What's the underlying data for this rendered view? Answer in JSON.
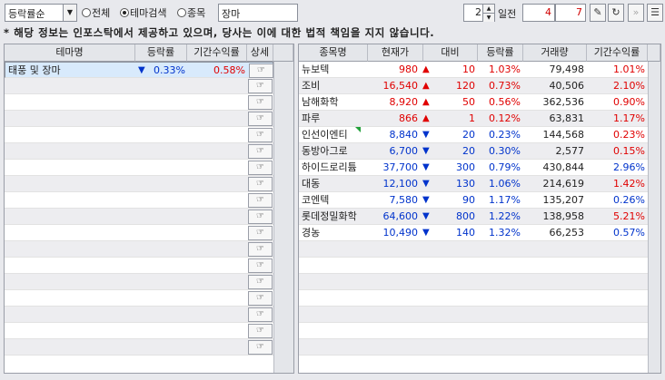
{
  "toolbar": {
    "sort_select": "등락률순",
    "radio_options": [
      {
        "label": "전체",
        "checked": false
      },
      {
        "label": "테마검색",
        "checked": true
      },
      {
        "label": "종목",
        "checked": false
      }
    ],
    "search_value": "장마",
    "days_value": "2",
    "days_label": "일전",
    "range_from": "4",
    "range_to": "7"
  },
  "notice": "* 해당 정보는 인포스탁에서 제공하고 있으며, 당사는 이에 대한 법적 책임을 지지 않습니다.",
  "theme_table": {
    "headers": [
      "테마명",
      "등락률",
      "기간수익률",
      "상세"
    ],
    "rows": [
      {
        "name": "태풍 및 장마",
        "change_arrow": "▼",
        "change": "0.33%",
        "period_return": "0.58%"
      }
    ],
    "detail_icon": "☞",
    "total_rows": 18
  },
  "stock_table": {
    "headers": [
      "종목명",
      "현재가",
      "대비",
      "등락률",
      "거래량",
      "기간수익률"
    ],
    "rows": [
      {
        "name": "뉴보텍",
        "price": "980",
        "dir": "up",
        "arrow": "▲",
        "diff": "10",
        "rate": "1.03%",
        "volume": "79,498",
        "period": "1.01%",
        "period_dir": "up"
      },
      {
        "name": "조비",
        "price": "16,540",
        "dir": "up",
        "arrow": "▲",
        "diff": "120",
        "rate": "0.73%",
        "volume": "40,506",
        "period": "2.10%",
        "period_dir": "up"
      },
      {
        "name": "남해화학",
        "price": "8,920",
        "dir": "up",
        "arrow": "▲",
        "diff": "50",
        "rate": "0.56%",
        "volume": "362,536",
        "period": "0.90%",
        "period_dir": "up"
      },
      {
        "name": "파루",
        "price": "866",
        "dir": "up",
        "arrow": "▲",
        "diff": "1",
        "rate": "0.12%",
        "volume": "63,831",
        "period": "1.17%",
        "period_dir": "up"
      },
      {
        "name": "인선이엔티",
        "price": "8,840",
        "dir": "down",
        "arrow": "▼",
        "diff": "20",
        "rate": "0.23%",
        "volume": "144,568",
        "period": "0.23%",
        "period_dir": "up"
      },
      {
        "name": "동방아그로",
        "price": "6,700",
        "dir": "down",
        "arrow": "▼",
        "diff": "20",
        "rate": "0.30%",
        "volume": "2,577",
        "period": "0.15%",
        "period_dir": "up"
      },
      {
        "name": "하이드로리튬",
        "price": "37,700",
        "dir": "down",
        "arrow": "▼",
        "diff": "300",
        "rate": "0.79%",
        "volume": "430,844",
        "period": "2.96%",
        "period_dir": "down"
      },
      {
        "name": "대동",
        "price": "12,100",
        "dir": "down",
        "arrow": "▼",
        "diff": "130",
        "rate": "1.06%",
        "volume": "214,619",
        "period": "1.42%",
        "period_dir": "up"
      },
      {
        "name": "코엔텍",
        "price": "7,580",
        "dir": "down",
        "arrow": "▼",
        "diff": "90",
        "rate": "1.17%",
        "volume": "135,207",
        "period": "0.26%",
        "period_dir": "down"
      },
      {
        "name": "롯데정밀화학",
        "price": "64,600",
        "dir": "down",
        "arrow": "▼",
        "diff": "800",
        "rate": "1.22%",
        "volume": "138,958",
        "period": "5.21%",
        "period_dir": "up"
      },
      {
        "name": "경농",
        "price": "10,490",
        "dir": "down",
        "arrow": "▼",
        "diff": "140",
        "rate": "1.32%",
        "volume": "66,253",
        "period": "0.57%",
        "period_dir": "down"
      }
    ],
    "total_rows": 18
  },
  "colors": {
    "up": "#e00000",
    "down": "#0033cc",
    "selected_row": "#d8eafc"
  }
}
